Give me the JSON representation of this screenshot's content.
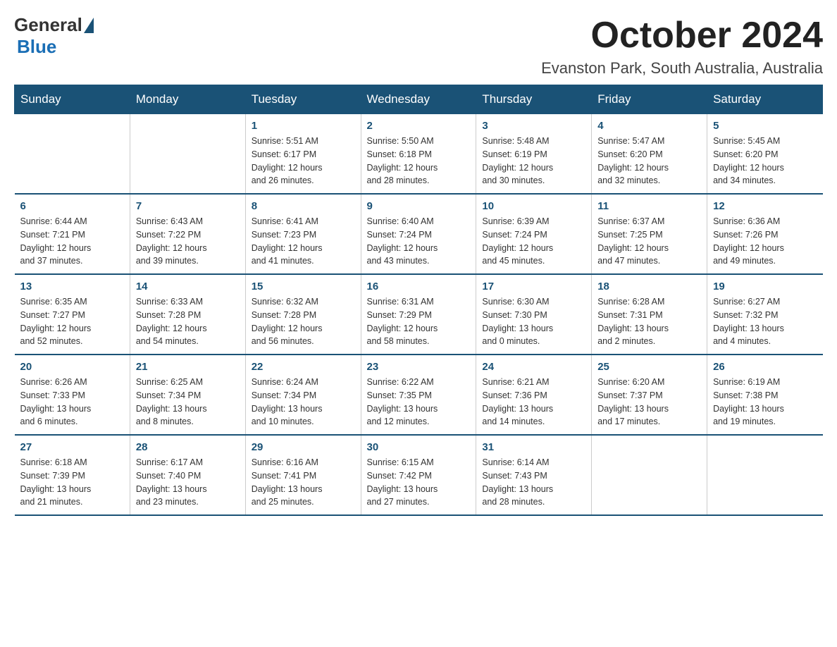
{
  "logo": {
    "general": "General",
    "blue": "Blue"
  },
  "title": {
    "month": "October 2024",
    "location": "Evanston Park, South Australia, Australia"
  },
  "weekdays": [
    "Sunday",
    "Monday",
    "Tuesday",
    "Wednesday",
    "Thursday",
    "Friday",
    "Saturday"
  ],
  "weeks": [
    [
      {
        "day": "",
        "info": ""
      },
      {
        "day": "",
        "info": ""
      },
      {
        "day": "1",
        "info": "Sunrise: 5:51 AM\nSunset: 6:17 PM\nDaylight: 12 hours\nand 26 minutes."
      },
      {
        "day": "2",
        "info": "Sunrise: 5:50 AM\nSunset: 6:18 PM\nDaylight: 12 hours\nand 28 minutes."
      },
      {
        "day": "3",
        "info": "Sunrise: 5:48 AM\nSunset: 6:19 PM\nDaylight: 12 hours\nand 30 minutes."
      },
      {
        "day": "4",
        "info": "Sunrise: 5:47 AM\nSunset: 6:20 PM\nDaylight: 12 hours\nand 32 minutes."
      },
      {
        "day": "5",
        "info": "Sunrise: 5:45 AM\nSunset: 6:20 PM\nDaylight: 12 hours\nand 34 minutes."
      }
    ],
    [
      {
        "day": "6",
        "info": "Sunrise: 6:44 AM\nSunset: 7:21 PM\nDaylight: 12 hours\nand 37 minutes."
      },
      {
        "day": "7",
        "info": "Sunrise: 6:43 AM\nSunset: 7:22 PM\nDaylight: 12 hours\nand 39 minutes."
      },
      {
        "day": "8",
        "info": "Sunrise: 6:41 AM\nSunset: 7:23 PM\nDaylight: 12 hours\nand 41 minutes."
      },
      {
        "day": "9",
        "info": "Sunrise: 6:40 AM\nSunset: 7:24 PM\nDaylight: 12 hours\nand 43 minutes."
      },
      {
        "day": "10",
        "info": "Sunrise: 6:39 AM\nSunset: 7:24 PM\nDaylight: 12 hours\nand 45 minutes."
      },
      {
        "day": "11",
        "info": "Sunrise: 6:37 AM\nSunset: 7:25 PM\nDaylight: 12 hours\nand 47 minutes."
      },
      {
        "day": "12",
        "info": "Sunrise: 6:36 AM\nSunset: 7:26 PM\nDaylight: 12 hours\nand 49 minutes."
      }
    ],
    [
      {
        "day": "13",
        "info": "Sunrise: 6:35 AM\nSunset: 7:27 PM\nDaylight: 12 hours\nand 52 minutes."
      },
      {
        "day": "14",
        "info": "Sunrise: 6:33 AM\nSunset: 7:28 PM\nDaylight: 12 hours\nand 54 minutes."
      },
      {
        "day": "15",
        "info": "Sunrise: 6:32 AM\nSunset: 7:28 PM\nDaylight: 12 hours\nand 56 minutes."
      },
      {
        "day": "16",
        "info": "Sunrise: 6:31 AM\nSunset: 7:29 PM\nDaylight: 12 hours\nand 58 minutes."
      },
      {
        "day": "17",
        "info": "Sunrise: 6:30 AM\nSunset: 7:30 PM\nDaylight: 13 hours\nand 0 minutes."
      },
      {
        "day": "18",
        "info": "Sunrise: 6:28 AM\nSunset: 7:31 PM\nDaylight: 13 hours\nand 2 minutes."
      },
      {
        "day": "19",
        "info": "Sunrise: 6:27 AM\nSunset: 7:32 PM\nDaylight: 13 hours\nand 4 minutes."
      }
    ],
    [
      {
        "day": "20",
        "info": "Sunrise: 6:26 AM\nSunset: 7:33 PM\nDaylight: 13 hours\nand 6 minutes."
      },
      {
        "day": "21",
        "info": "Sunrise: 6:25 AM\nSunset: 7:34 PM\nDaylight: 13 hours\nand 8 minutes."
      },
      {
        "day": "22",
        "info": "Sunrise: 6:24 AM\nSunset: 7:34 PM\nDaylight: 13 hours\nand 10 minutes."
      },
      {
        "day": "23",
        "info": "Sunrise: 6:22 AM\nSunset: 7:35 PM\nDaylight: 13 hours\nand 12 minutes."
      },
      {
        "day": "24",
        "info": "Sunrise: 6:21 AM\nSunset: 7:36 PM\nDaylight: 13 hours\nand 14 minutes."
      },
      {
        "day": "25",
        "info": "Sunrise: 6:20 AM\nSunset: 7:37 PM\nDaylight: 13 hours\nand 17 minutes."
      },
      {
        "day": "26",
        "info": "Sunrise: 6:19 AM\nSunset: 7:38 PM\nDaylight: 13 hours\nand 19 minutes."
      }
    ],
    [
      {
        "day": "27",
        "info": "Sunrise: 6:18 AM\nSunset: 7:39 PM\nDaylight: 13 hours\nand 21 minutes."
      },
      {
        "day": "28",
        "info": "Sunrise: 6:17 AM\nSunset: 7:40 PM\nDaylight: 13 hours\nand 23 minutes."
      },
      {
        "day": "29",
        "info": "Sunrise: 6:16 AM\nSunset: 7:41 PM\nDaylight: 13 hours\nand 25 minutes."
      },
      {
        "day": "30",
        "info": "Sunrise: 6:15 AM\nSunset: 7:42 PM\nDaylight: 13 hours\nand 27 minutes."
      },
      {
        "day": "31",
        "info": "Sunrise: 6:14 AM\nSunset: 7:43 PM\nDaylight: 13 hours\nand 28 minutes."
      },
      {
        "day": "",
        "info": ""
      },
      {
        "day": "",
        "info": ""
      }
    ]
  ]
}
